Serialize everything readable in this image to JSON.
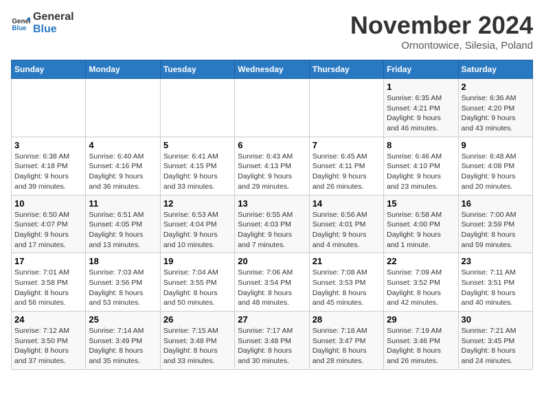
{
  "logo": {
    "line1": "General",
    "line2": "Blue"
  },
  "title": "November 2024",
  "subtitle": "Ornontowice, Silesia, Poland",
  "headers": [
    "Sunday",
    "Monday",
    "Tuesday",
    "Wednesday",
    "Thursday",
    "Friday",
    "Saturday"
  ],
  "weeks": [
    [
      {
        "day": "",
        "detail": ""
      },
      {
        "day": "",
        "detail": ""
      },
      {
        "day": "",
        "detail": ""
      },
      {
        "day": "",
        "detail": ""
      },
      {
        "day": "",
        "detail": ""
      },
      {
        "day": "1",
        "detail": "Sunrise: 6:35 AM\nSunset: 4:21 PM\nDaylight: 9 hours\nand 46 minutes."
      },
      {
        "day": "2",
        "detail": "Sunrise: 6:36 AM\nSunset: 4:20 PM\nDaylight: 9 hours\nand 43 minutes."
      }
    ],
    [
      {
        "day": "3",
        "detail": "Sunrise: 6:38 AM\nSunset: 4:18 PM\nDaylight: 9 hours\nand 39 minutes."
      },
      {
        "day": "4",
        "detail": "Sunrise: 6:40 AM\nSunset: 4:16 PM\nDaylight: 9 hours\nand 36 minutes."
      },
      {
        "day": "5",
        "detail": "Sunrise: 6:41 AM\nSunset: 4:15 PM\nDaylight: 9 hours\nand 33 minutes."
      },
      {
        "day": "6",
        "detail": "Sunrise: 6:43 AM\nSunset: 4:13 PM\nDaylight: 9 hours\nand 29 minutes."
      },
      {
        "day": "7",
        "detail": "Sunrise: 6:45 AM\nSunset: 4:11 PM\nDaylight: 9 hours\nand 26 minutes."
      },
      {
        "day": "8",
        "detail": "Sunrise: 6:46 AM\nSunset: 4:10 PM\nDaylight: 9 hours\nand 23 minutes."
      },
      {
        "day": "9",
        "detail": "Sunrise: 6:48 AM\nSunset: 4:08 PM\nDaylight: 9 hours\nand 20 minutes."
      }
    ],
    [
      {
        "day": "10",
        "detail": "Sunrise: 6:50 AM\nSunset: 4:07 PM\nDaylight: 9 hours\nand 17 minutes."
      },
      {
        "day": "11",
        "detail": "Sunrise: 6:51 AM\nSunset: 4:05 PM\nDaylight: 9 hours\nand 13 minutes."
      },
      {
        "day": "12",
        "detail": "Sunrise: 6:53 AM\nSunset: 4:04 PM\nDaylight: 9 hours\nand 10 minutes."
      },
      {
        "day": "13",
        "detail": "Sunrise: 6:55 AM\nSunset: 4:03 PM\nDaylight: 9 hours\nand 7 minutes."
      },
      {
        "day": "14",
        "detail": "Sunrise: 6:56 AM\nSunset: 4:01 PM\nDaylight: 9 hours\nand 4 minutes."
      },
      {
        "day": "15",
        "detail": "Sunrise: 6:58 AM\nSunset: 4:00 PM\nDaylight: 9 hours\nand 1 minute."
      },
      {
        "day": "16",
        "detail": "Sunrise: 7:00 AM\nSunset: 3:59 PM\nDaylight: 8 hours\nand 59 minutes."
      }
    ],
    [
      {
        "day": "17",
        "detail": "Sunrise: 7:01 AM\nSunset: 3:58 PM\nDaylight: 8 hours\nand 56 minutes."
      },
      {
        "day": "18",
        "detail": "Sunrise: 7:03 AM\nSunset: 3:56 PM\nDaylight: 8 hours\nand 53 minutes."
      },
      {
        "day": "19",
        "detail": "Sunrise: 7:04 AM\nSunset: 3:55 PM\nDaylight: 8 hours\nand 50 minutes."
      },
      {
        "day": "20",
        "detail": "Sunrise: 7:06 AM\nSunset: 3:54 PM\nDaylight: 8 hours\nand 48 minutes."
      },
      {
        "day": "21",
        "detail": "Sunrise: 7:08 AM\nSunset: 3:53 PM\nDaylight: 8 hours\nand 45 minutes."
      },
      {
        "day": "22",
        "detail": "Sunrise: 7:09 AM\nSunset: 3:52 PM\nDaylight: 8 hours\nand 42 minutes."
      },
      {
        "day": "23",
        "detail": "Sunrise: 7:11 AM\nSunset: 3:51 PM\nDaylight: 8 hours\nand 40 minutes."
      }
    ],
    [
      {
        "day": "24",
        "detail": "Sunrise: 7:12 AM\nSunset: 3:50 PM\nDaylight: 8 hours\nand 37 minutes."
      },
      {
        "day": "25",
        "detail": "Sunrise: 7:14 AM\nSunset: 3:49 PM\nDaylight: 8 hours\nand 35 minutes."
      },
      {
        "day": "26",
        "detail": "Sunrise: 7:15 AM\nSunset: 3:48 PM\nDaylight: 8 hours\nand 33 minutes."
      },
      {
        "day": "27",
        "detail": "Sunrise: 7:17 AM\nSunset: 3:48 PM\nDaylight: 8 hours\nand 30 minutes."
      },
      {
        "day": "28",
        "detail": "Sunrise: 7:18 AM\nSunset: 3:47 PM\nDaylight: 8 hours\nand 28 minutes."
      },
      {
        "day": "29",
        "detail": "Sunrise: 7:19 AM\nSunset: 3:46 PM\nDaylight: 8 hours\nand 26 minutes."
      },
      {
        "day": "30",
        "detail": "Sunrise: 7:21 AM\nSunset: 3:45 PM\nDaylight: 8 hours\nand 24 minutes."
      }
    ]
  ]
}
